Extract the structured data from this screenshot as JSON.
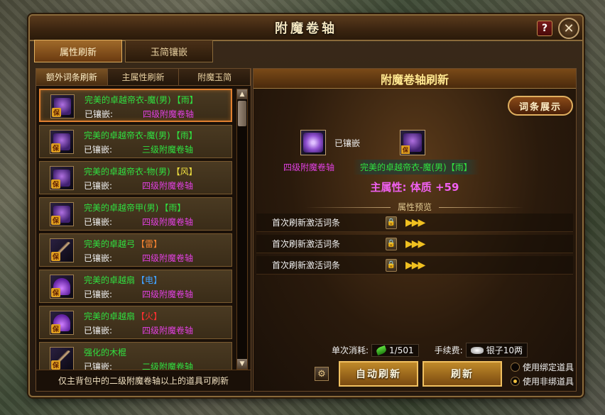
{
  "window": {
    "title": "附魔卷轴",
    "help_label": "?",
    "close_label": "✕"
  },
  "top_tabs": [
    {
      "label": "属性刷新",
      "active": true
    },
    {
      "label": "玉简镶嵌",
      "active": false
    }
  ],
  "sub_tabs": [
    {
      "label": "额外词条刷新",
      "active": true
    },
    {
      "label": "主属性刷新",
      "active": false
    },
    {
      "label": "附魔玉简",
      "active": false
    }
  ],
  "items": [
    {
      "name": "完美的卓越帝衣-魔(男)",
      "tag": "【雨】",
      "tag_color": "#30e040",
      "embed_label": "已镶嵌:",
      "embed_value": "四级附魔卷轴",
      "embed_color": "#e040e0",
      "icon": "armor-icon",
      "selected": true
    },
    {
      "name": "完美的卓越帝衣-魔(男)",
      "tag": "【雨】",
      "tag_color": "#30e040",
      "embed_label": "已镶嵌:",
      "embed_value": "三级附魔卷轴",
      "embed_color": "#30e040",
      "icon": "armor-icon",
      "selected": false
    },
    {
      "name": "完美的卓越帝衣-物(男)",
      "tag": "【风】",
      "tag_color": "#f0e040",
      "embed_label": "已镶嵌:",
      "embed_value": "四级附魔卷轴",
      "embed_color": "#e040e0",
      "icon": "armor-icon",
      "selected": false
    },
    {
      "name": "完美的卓越帝甲(男)",
      "tag": "【雨】",
      "tag_color": "#30e040",
      "embed_label": "已镶嵌:",
      "embed_value": "四级附魔卷轴",
      "embed_color": "#e040e0",
      "icon": "armor-icon",
      "selected": false
    },
    {
      "name": "完美的卓越弓",
      "tag": "【雷】",
      "tag_color": "#f08030",
      "embed_label": "已镶嵌:",
      "embed_value": "四级附魔卷轴",
      "embed_color": "#e040e0",
      "icon": "bow-icon",
      "selected": false
    },
    {
      "name": "完美的卓越扇",
      "tag": "【电】",
      "tag_color": "#40a0ff",
      "embed_label": "已镶嵌:",
      "embed_value": "四级附魔卷轴",
      "embed_color": "#e040e0",
      "icon": "fan-icon",
      "selected": false
    },
    {
      "name": "完美的卓越扇",
      "tag": "【火】",
      "tag_color": "#ff3030",
      "embed_label": "已镶嵌:",
      "embed_value": "四级附魔卷轴",
      "embed_color": "#e040e0",
      "icon": "fan-icon",
      "selected": false
    },
    {
      "name": "强化的木棍",
      "tag": "",
      "tag_color": "#30e040",
      "embed_label": "已镶嵌:",
      "embed_value": "二级附魔卷轴",
      "embed_color": "#30e040",
      "icon": "staff-icon",
      "selected": false
    }
  ],
  "left_footer": "仅主背包中的二级附魔卷轴以上的道具可刷新",
  "right": {
    "header": "附魔卷轴刷新",
    "entry_button": "词条展示",
    "embedded_label": "已镶嵌",
    "scroll_name": "四级附魔卷轴",
    "equip_name": "完美的卓越帝衣-魔(男)【雨】",
    "main_attr": "主属性: 体质  +59",
    "preview_title": "属性预览",
    "rows": [
      {
        "label": "首次刷新激活词条",
        "arrows": "▶▶▶"
      },
      {
        "label": "首次刷新激活词条",
        "arrows": "▶▶▶"
      },
      {
        "label": "首次刷新激活词条",
        "arrows": "▶▶▶"
      }
    ],
    "cost_label": "单次消耗:",
    "cost_value": "1/501",
    "fee_label": "手续费:",
    "fee_value": "银子10两",
    "auto_refresh": "自动刷新",
    "refresh": "刷新",
    "option_bound": "使用绑定道具",
    "option_unbound": "使用非绑道具",
    "selected_option": "使用非绑道具"
  },
  "bao_badge": "保"
}
